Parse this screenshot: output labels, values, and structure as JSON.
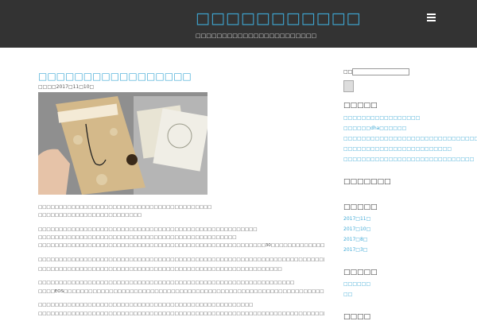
{
  "header": {
    "site_title": "□□□□□□□□□□□",
    "site_description": "□□□□□□□□□□□□□□□□□□□□□□□"
  },
  "post": {
    "title": "□□□□□□□□□□□□□□□□□",
    "meta": "□□□□2017□11□10□",
    "paragraphs": [
      "□□□□□□□□□□□□□□□□□□□□□□□□□□□□□□□□□□□□□□□□□□",
      "□□□□□□□□□□□□□□□□□□□□□□□□□",
      "□□□□□□□□□□□□□□□□□□□□□□□□□□□□□□□□□□□□□□□□□□□□□□□□□□□□□",
      "□□□□□□□□□□□□□□□□□□□□□□□□□□□□□□□□□□□□□□□□□□□□□□□□",
      "□□□□□□□□□□□□□□□□□□□□□□□□□□□□□□□□□□□□□□□□□□□□□□□□□□□□□□□30□□□□□□□□□□□□□□□□",
      "□□□□□□□□□□□□□□□□□□□□□□□□□□□□□□□□□□□□□□□□□□□□□□□□□□□□□□□□□□□□□□□□□□□□□□□□□□□□□□□□□□□□□□□□□□□□□□□□□□",
      "□□□□□□□□□□□□□□□□□□□□□□□□□□□□□□□□□□□□□□□□□□□□□□□□□□□□□□□□□□□",
      "□□□□□□□□□□□□□□□□□□□□□□□□□□□□□□□□□□□□□□□□□□□□□□□□□□□□□□□□□□□□□□",
      "□□□□EOS□□□□□□□□□□□□□□□□□□□□□□□□□□□□□□□□□□□□□□□□□□□□□□□□□□□□□□□□□□□□□□□□□□□□□□□□□□□□□□□□□□□□□□□□□□",
      "□□□□□□□□□□□□□□□□□□□□□□□□□□□□□□□□□□□□□□□□□□□□□□□□□□□□",
      "□□□□□□□□□□□□□□□□□□□□□□□□□□□□□□□□□□□□□□□□□□□□□□□□□□□□□□□□□□□□□□□□□□□□□□□□□□□□□□□□□□□□□□□□□□□□□□□□□□□□"
    ]
  },
  "sidebar": {
    "search_label": "□□",
    "recent_title": "□□□□□",
    "recent_posts": [
      "□□□□□□□□□□□□□□□□□",
      "□□□□□□dha□□□□□□",
      "□□□□□□□□□□□□□□□□□□□□□□□□□□□□□□",
      "□□□□□□□□□□□□□□□□□□□□□□□□",
      "□□□□□□□□□□□□□□□□□□□□□□□□□□□□□"
    ],
    "comments_title": "□□□□□□□",
    "archives_title": "□□□□□",
    "archives": [
      "2017□11□",
      "2017□10□",
      "2017□8□",
      "2017□3□"
    ],
    "categories_title": "□□□□□",
    "categories": [
      "□□□□□□",
      "□□"
    ],
    "meta_title": "□□□□"
  }
}
